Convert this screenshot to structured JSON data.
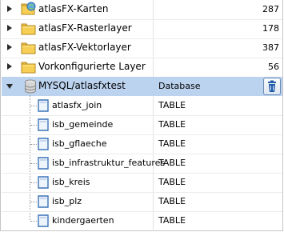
{
  "tree": {
    "layers": [
      {
        "label": "atlasFX-Karten",
        "count": "287",
        "icon": "folder-globe-icon"
      },
      {
        "label": "atlasFX-Rasterlayer",
        "count": "178",
        "icon": "folder-icon"
      },
      {
        "label": "atlasFX-Vektorlayer",
        "count": "387",
        "icon": "folder-icon"
      },
      {
        "label": "Vorkonfigurierte Layer",
        "count": "56",
        "icon": "folder-icon"
      }
    ],
    "database": {
      "label": "MYSQL/atlasfxtest",
      "type": "Database",
      "icon": "database-icon"
    },
    "tables": [
      {
        "label": "atlasfx_join",
        "type": "TABLE"
      },
      {
        "label": "isb_gemeinde",
        "type": "TABLE"
      },
      {
        "label": "isb_gflaeche",
        "type": "TABLE"
      },
      {
        "label": "isb_infrastruktur_features",
        "type": "TABLE"
      },
      {
        "label": "isb_kreis",
        "type": "TABLE"
      },
      {
        "label": "isb_plz",
        "type": "TABLE"
      },
      {
        "label": "kindergaerten",
        "type": "TABLE"
      }
    ]
  },
  "colors": {
    "selection": "#bcd3ef",
    "accent": "#1d5aa8"
  }
}
